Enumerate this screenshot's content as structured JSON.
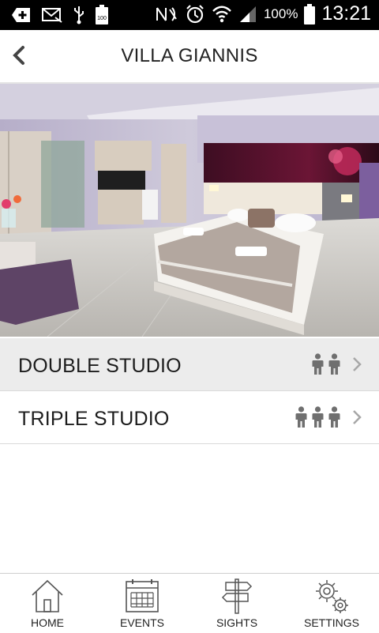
{
  "status_bar": {
    "battery_percent": "100%",
    "time": "13:21",
    "left_icons": [
      "add-icon",
      "mail-icon",
      "usb-icon",
      "battery-100-icon"
    ],
    "right_icons": [
      "nfc-icon",
      "alarm-icon",
      "wifi-icon",
      "signal-icon",
      "battery-icon"
    ]
  },
  "header": {
    "title": "VILLA GIANNIS",
    "back_icon": "chevron-left-icon"
  },
  "hero": {
    "image": "hotel-room-photo"
  },
  "rooms": [
    {
      "name": "DOUBLE STUDIO",
      "capacity": 2,
      "highlighted": true
    },
    {
      "name": "TRIPLE STUDIO",
      "capacity": 3,
      "highlighted": false
    }
  ],
  "bottom_nav": [
    {
      "label": "HOME",
      "icon": "home-icon"
    },
    {
      "label": "EVENTS",
      "icon": "calendar-icon"
    },
    {
      "label": "SIGHTS",
      "icon": "signpost-icon"
    },
    {
      "label": "SETTINGS",
      "icon": "gears-icon"
    }
  ],
  "colors": {
    "status_bar": "#000000",
    "icon_gray": "#6f6f6f",
    "row_highlight": "#ececec",
    "divider": "#d9d9d9"
  }
}
